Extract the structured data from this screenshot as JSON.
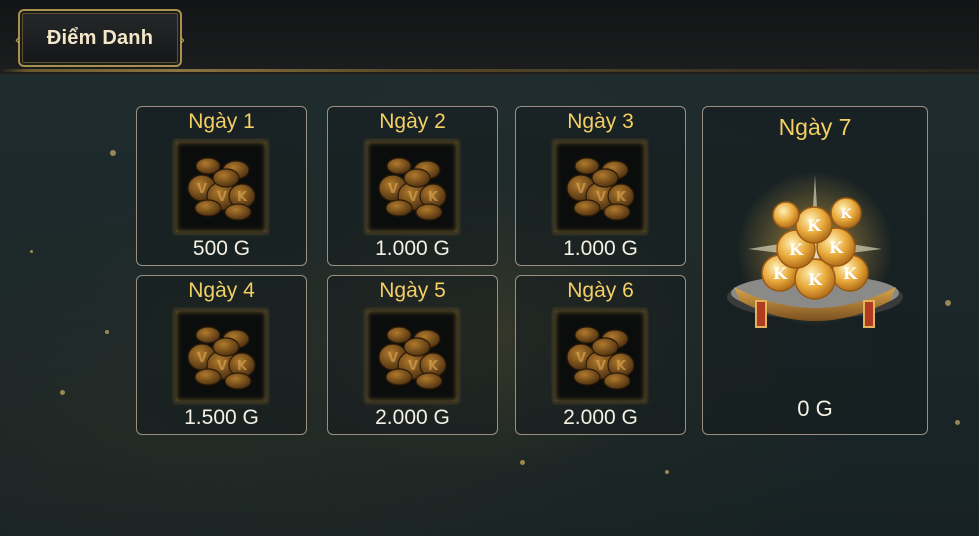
{
  "header": {
    "title": "Điểm Danh"
  },
  "days": [
    {
      "label": "Ngày 1",
      "reward": "500 G",
      "icon": "gold-coins-icon"
    },
    {
      "label": "Ngày 2",
      "reward": "1.000 G",
      "icon": "gold-coins-icon"
    },
    {
      "label": "Ngày 3",
      "reward": "1.000 G",
      "icon": "gold-coins-icon"
    },
    {
      "label": "Ngày 4",
      "reward": "1.500 G",
      "icon": "gold-coins-icon"
    },
    {
      "label": "Ngày 5",
      "reward": "2.000 G",
      "icon": "gold-coins-icon"
    },
    {
      "label": "Ngày 6",
      "reward": "2.000 G",
      "icon": "gold-coins-icon"
    }
  ],
  "big_day": {
    "label": "Ngày 7",
    "reward": "0 G",
    "icon": "treasure-chest-icon"
  },
  "colors": {
    "day_label": "#f4cf63",
    "amount": "#f4f0e4",
    "card_border": "#9a8f80",
    "frame_gold": "#a8904f"
  }
}
